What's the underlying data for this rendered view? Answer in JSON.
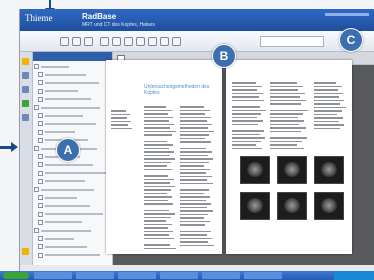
{
  "window": {
    "title_logo": "Thieme",
    "book_title": "RadBase",
    "book_subtitle": "MRT und CT des Kopfes, Halses"
  },
  "callouts": {
    "a": "A",
    "b": "B",
    "c": "C"
  },
  "colors": {
    "title_bar": "#2f69c4",
    "badge": "#3d6fb0",
    "reader_background": "#58595d",
    "heading_blue": "#4b8fd0",
    "taskbar": "#245ab4"
  },
  "toc": {
    "item_count": 24
  },
  "reader": {
    "left_page_heading": "Untersuchungsmethoden des Kopfes",
    "image_count": 6
  }
}
